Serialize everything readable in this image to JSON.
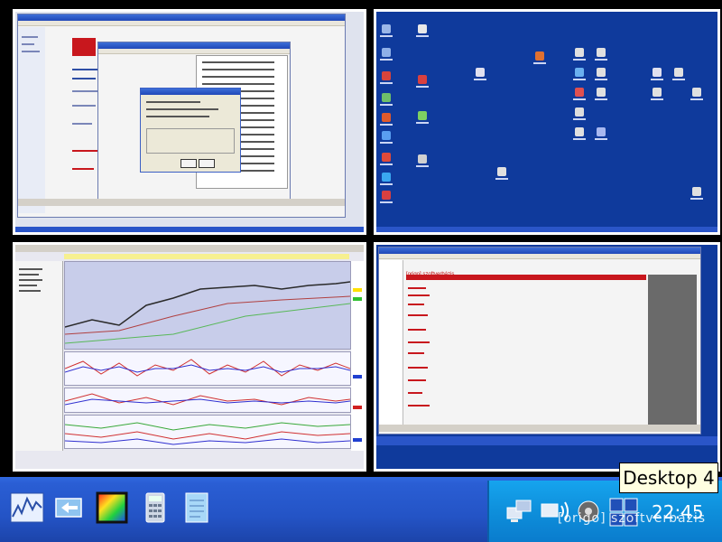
{
  "tooltip": {
    "text": "Desktop 4"
  },
  "clock": {
    "time": "22:45"
  },
  "watermark": {
    "left": "[origo]",
    "right": "szoftverbázis"
  },
  "panes": [
    {
      "name": "desktop-1"
    },
    {
      "name": "desktop-2"
    },
    {
      "name": "desktop-3"
    },
    {
      "name": "desktop-4"
    }
  ],
  "page4": {
    "header": "[origo] szoftverbázis"
  },
  "quick_launch": [
    {
      "icon": "stock-chart-icon"
    },
    {
      "icon": "network-share-icon"
    },
    {
      "icon": "spectrum-image-icon"
    },
    {
      "icon": "calculator-icon"
    },
    {
      "icon": "notepad-icon"
    }
  ],
  "tray_icons": [
    "network-computers-icon",
    "wireless-icon",
    "volume-icon",
    "desktop-switcher-icon"
  ],
  "colors": {
    "taskbar": "#2454c6",
    "tray": "#0e8fdb",
    "desktop": "#0f3a9c"
  }
}
